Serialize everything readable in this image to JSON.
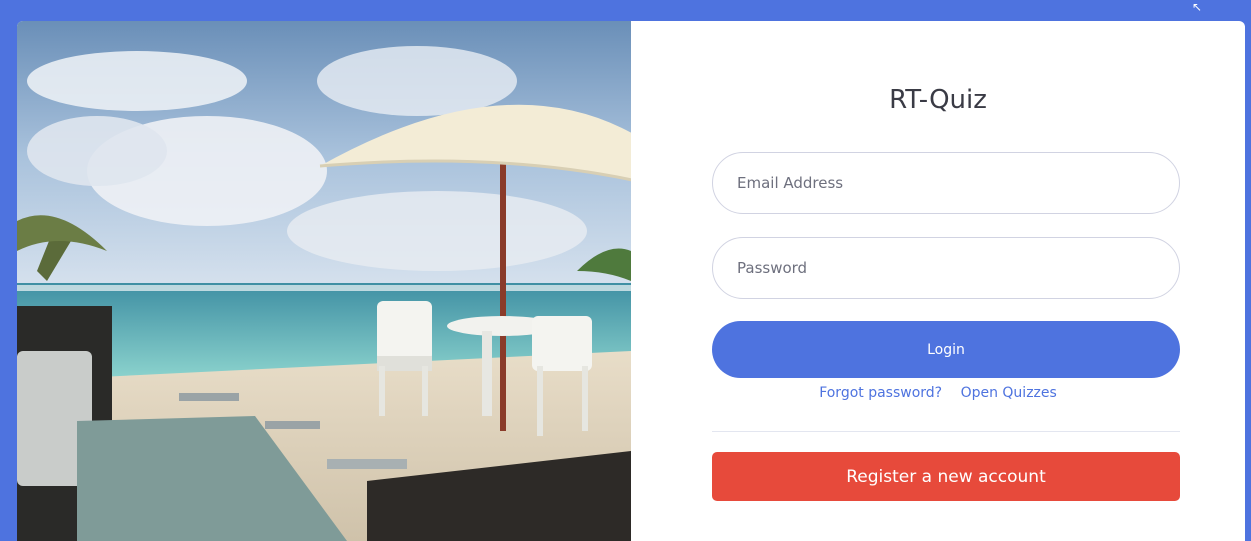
{
  "app": {
    "title": "RT-Quiz"
  },
  "form": {
    "email_placeholder": "Email Address",
    "password_placeholder": "Password",
    "login_label": "Login",
    "forgot_label": "Forgot password?",
    "open_quizzes_label": "Open Quizzes",
    "register_label": "Register a new account"
  },
  "colors": {
    "background": "#4e73df",
    "primary": "#4e73df",
    "danger": "#e74a3b",
    "title_text": "#3a3b45"
  }
}
